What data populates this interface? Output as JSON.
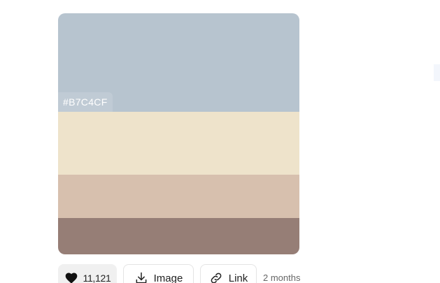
{
  "palette": {
    "colors": [
      "#B7C4CF",
      "#EEE3CB",
      "#D7C0AE",
      "#967E76"
    ],
    "shown_hex": "#B7C4CF",
    "swatch_fractions": [
      0.41,
      0.26,
      0.18,
      0.15
    ]
  },
  "actions": {
    "like_count": "11,121",
    "image_label": "Image",
    "link_label": "Link",
    "time_ago": "2 months"
  },
  "icons": {
    "like": "heart-icon",
    "image": "download-icon",
    "link": "link-icon"
  }
}
